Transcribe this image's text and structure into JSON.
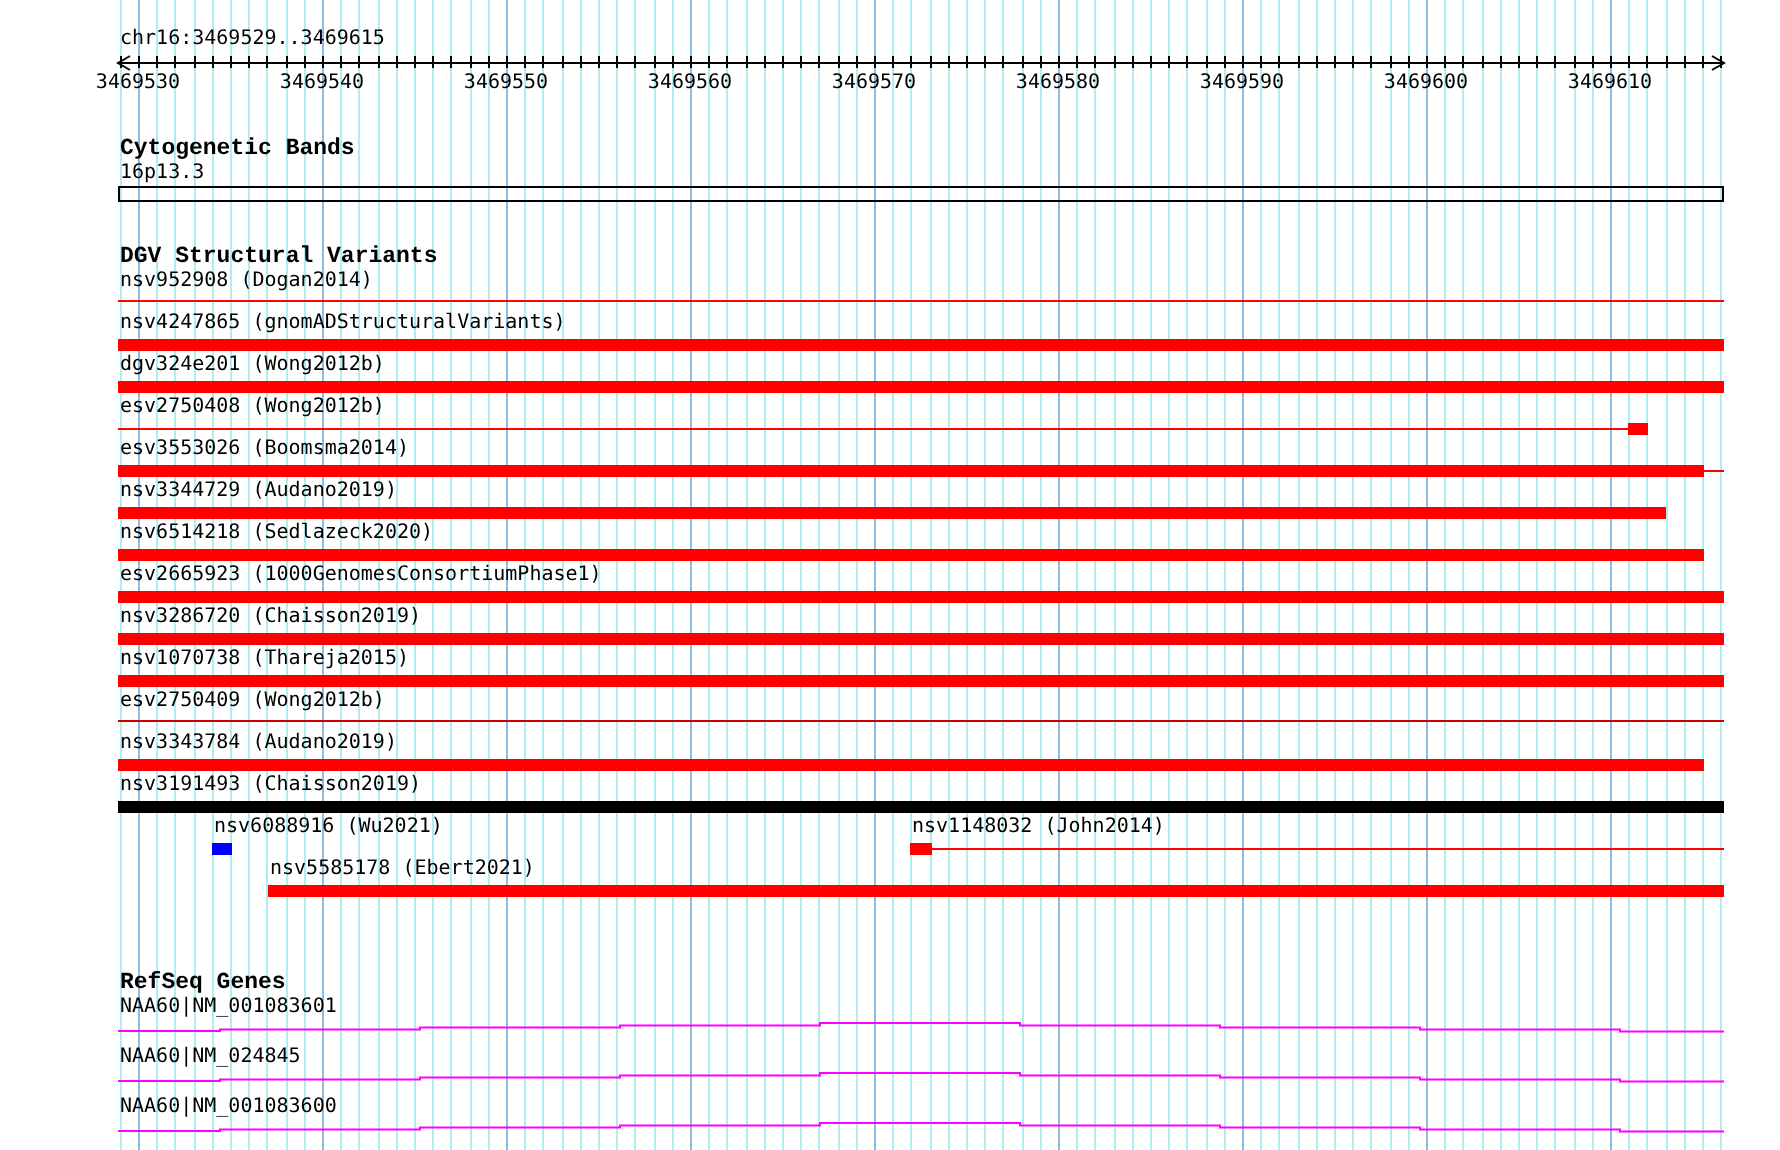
{
  "ruler": {
    "region": "chr16:3469529..3469615",
    "ticks": [
      "3469530",
      "3469540",
      "3469550",
      "3469560",
      "3469570",
      "3469580",
      "3469590",
      "3469600",
      "3469610"
    ]
  },
  "cytobands": {
    "title": "Cytogenetic Bands",
    "label": "16p13.3"
  },
  "dgv": {
    "title": "DGV Structural Variants",
    "rows": [
      {
        "features": [
          {
            "label": "nsv952908 (Dogan2014)",
            "kind": "line",
            "color": "#ff0000"
          }
        ]
      },
      {
        "features": [
          {
            "label": "nsv4247865 (gnomADStructuralVariants)",
            "kind": "bar",
            "color": "#ff0000"
          }
        ]
      },
      {
        "features": [
          {
            "label": "dgv324e201 (Wong2012b)",
            "kind": "bar",
            "color": "#ff0000"
          }
        ]
      },
      {
        "features": [
          {
            "label": "esv2750408 (Wong2012b)",
            "kind": "line",
            "color": "#ff0000"
          }
        ]
      },
      {
        "features": [
          {
            "label": "esv3553026 (Boomsma2014)",
            "kind": "bar",
            "color": "#ff0000"
          }
        ]
      },
      {
        "features": [
          {
            "label": "nsv3344729 (Audano2019)",
            "kind": "bar",
            "color": "#ff0000"
          }
        ]
      },
      {
        "features": [
          {
            "label": "nsv6514218 (Sedlazeck2020)",
            "kind": "bar",
            "color": "#ff0000"
          }
        ]
      },
      {
        "features": [
          {
            "label": "esv2665923 (1000GenomesConsortiumPhase1)",
            "kind": "bar",
            "color": "#ff0000"
          }
        ]
      },
      {
        "features": [
          {
            "label": "nsv3286720 (Chaisson2019)",
            "kind": "bar",
            "color": "#ff0000"
          }
        ]
      },
      {
        "features": [
          {
            "label": "nsv1070738 (Thareja2015)",
            "kind": "bar",
            "color": "#ff0000"
          }
        ]
      },
      {
        "features": [
          {
            "label": "esv2750409 (Wong2012b)",
            "kind": "line",
            "color": "#cc0000"
          }
        ]
      },
      {
        "features": [
          {
            "label": "nsv3343784 (Audano2019)",
            "kind": "bar",
            "color": "#ff0000"
          }
        ]
      },
      {
        "features": [
          {
            "label": "nsv3191493 (Chaisson2019)",
            "kind": "bar",
            "color": "#000000"
          }
        ]
      },
      {
        "features": [
          {
            "label": "nsv6088916 (Wu2021)",
            "kind": "bar",
            "color": "#0000ff"
          },
          {
            "label": "nsv1148032 (John2014)",
            "kind": "line",
            "color": "#ff0000"
          }
        ]
      },
      {
        "features": [
          {
            "label": "nsv5585178 (Ebert2021)",
            "kind": "bar",
            "color": "#ff0000"
          }
        ]
      }
    ]
  },
  "refseq": {
    "title": "RefSeq Genes",
    "transcripts": [
      {
        "label": "NAA60|NM_001083601"
      },
      {
        "label": "NAA60|NM_024845"
      },
      {
        "label": "NAA60|NM_001083600"
      }
    ]
  }
}
